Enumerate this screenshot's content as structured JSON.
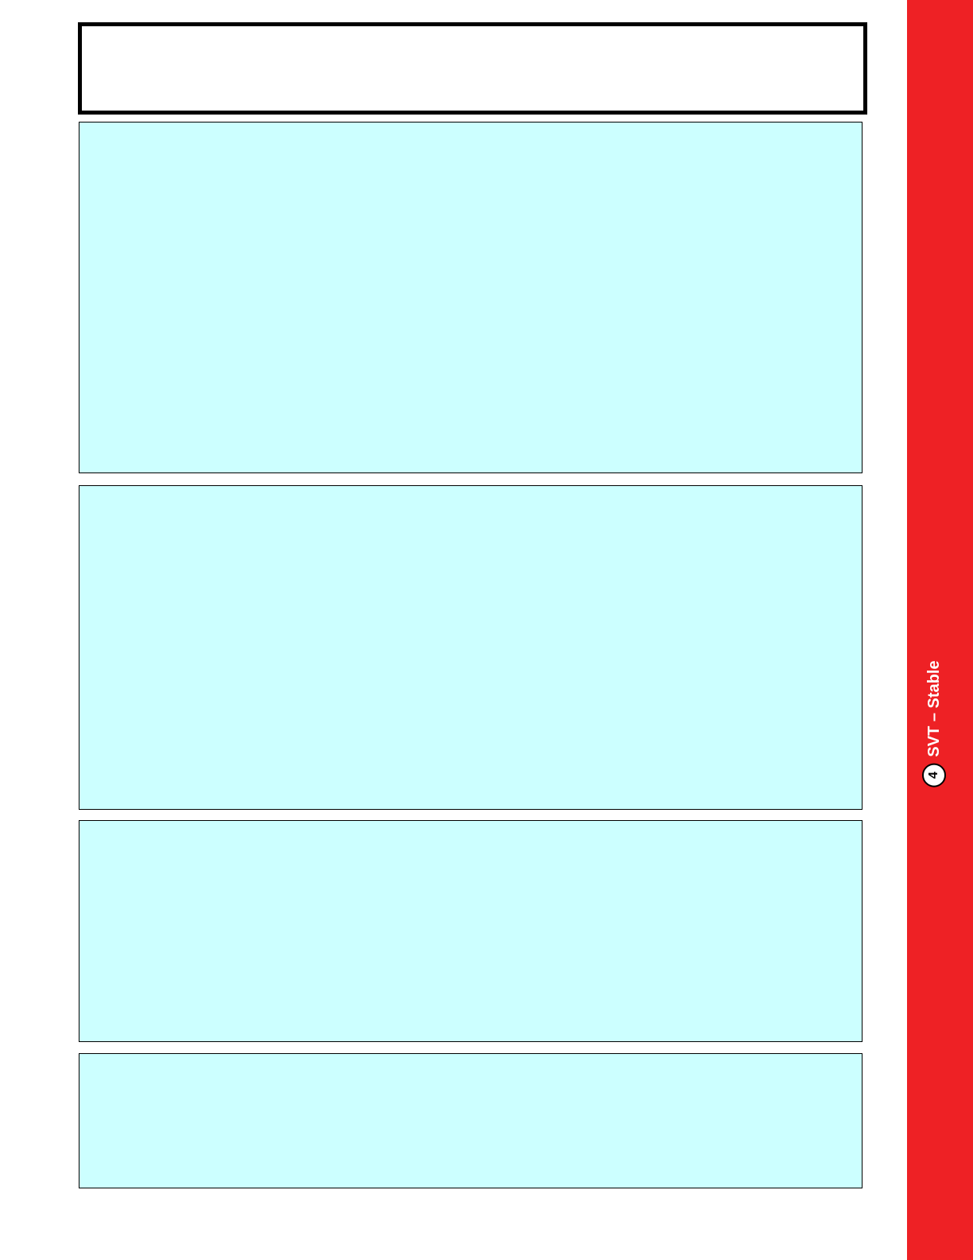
{
  "colors": {
    "panel_fill": "#ccffff",
    "side_tab": "#ee2125",
    "border": "#000000"
  },
  "side_tab": {
    "number": "4",
    "label": "SVT – Stable"
  }
}
